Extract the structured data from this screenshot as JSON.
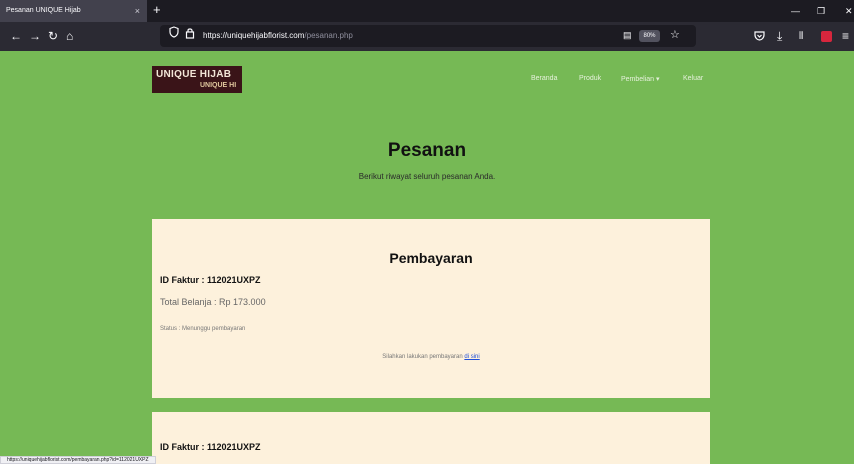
{
  "browser": {
    "tab_title": "Pesanan UNIQUE Hijab",
    "tab_close": "×",
    "new_tab": "+",
    "url_domain": "https://uniquehijabflorist.com",
    "url_path": "/pesanan.php",
    "zoom": "80%",
    "status_url": "https://uniquehijabflorist.com/pembayaran.php?id=112021UXPZ",
    "icons": [
      "back-icon",
      "forward-icon",
      "reload-icon",
      "home-icon",
      "shield-icon",
      "lock-icon",
      "reader-icon",
      "bookmark-star-icon",
      "pocket-icon",
      "download-icon",
      "library-icon",
      "extension-icon",
      "menu-icon",
      "minimize-icon",
      "maximize-icon",
      "close-icon"
    ]
  },
  "site": {
    "logo_line1": "UNIQUE HIJAB",
    "logo_line2": "UNIQUE HI",
    "nav": [
      "Beranda",
      "Produk",
      "Pembelian ▾",
      "Keluar"
    ]
  },
  "main": {
    "title": "Pesanan",
    "subtitle": "Berikut riwayat seluruh pesanan Anda."
  },
  "orders": [
    {
      "heading": "Pembayaran",
      "invoice": "ID Faktur : 112021UXPZ",
      "total": "Total Belanja : Rp 173.000",
      "status": "Status : Menunggu pembayaran",
      "pay_note": "Silahkan lakukan pembayaran",
      "pay_link": "di sini"
    },
    {
      "invoice": "ID Faktur : 112021UXPZ"
    }
  ],
  "colors": {
    "page_bg": "#76b955",
    "card_bg": "#fdf1dc",
    "browser_chrome": "#2b2a33",
    "link": "#1f4ed8"
  }
}
